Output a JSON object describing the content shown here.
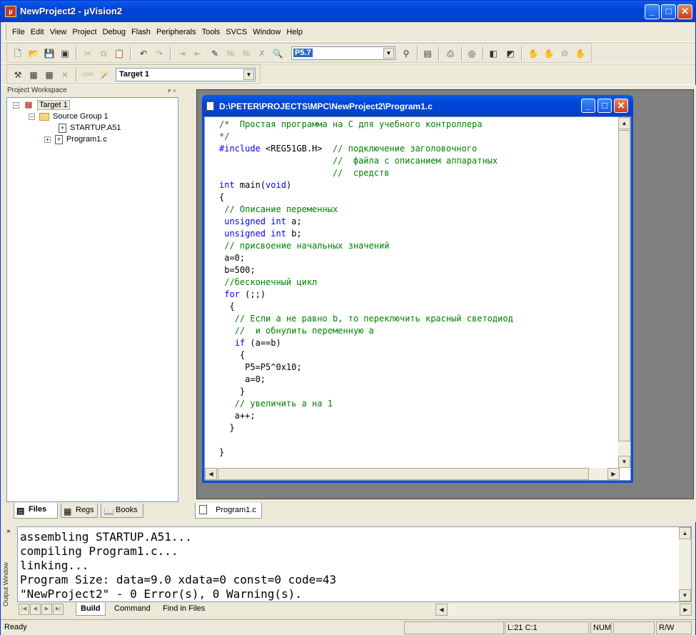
{
  "window": {
    "title": "NewProject2 - µVision2",
    "min_glyph": "_",
    "max_glyph": "□",
    "close_glyph": "✕"
  },
  "menu": [
    "File",
    "Edit",
    "View",
    "Project",
    "Debug",
    "Flash",
    "Peripherals",
    "Tools",
    "SVCS",
    "Window",
    "Help"
  ],
  "toolbar": {
    "find_combo_value": "P5.7",
    "target_combo_value": "Target 1",
    "load_label": "LOAD"
  },
  "workspace": {
    "title": "Project Workspace",
    "title_controls": "▾ ×",
    "tree": {
      "target": "Target 1",
      "group": "Source Group 1",
      "files": [
        "STARTUP.A51",
        "Program1.c"
      ]
    },
    "tabs": [
      "Files",
      "Regs",
      "Books"
    ]
  },
  "editor": {
    "title": "D:\\PETER\\PROJECTS\\MPC\\NewProject2\\Program1.c",
    "tab_label": "Program1.c",
    "code_lines": [
      "/*  Простая программа на С для учебного контроллера",
      "*/",
      "#include <REG51GB.H>  // подключение заголовочного",
      "                      //  файла с описанием аппаратных",
      "                      //  средств",
      "int main(void)",
      "{",
      " // Описание переменных",
      " unsigned int a;",
      " unsigned int b;",
      " // присвоение начальных значений",
      " a=0;",
      " b=500;",
      " //бесконечный цикл",
      " for (;;)",
      "  {",
      "   // Если а не равно b, то переключить красный светодиод",
      "   //  и обнулить переменную а",
      "   if (a==b)",
      "    {",
      "     P5=P5^0x10;",
      "     a=0;",
      "    }",
      "   // увеличить а на 1",
      "   a++;",
      "  }",
      "",
      "}"
    ]
  },
  "output": {
    "title": "Output Window",
    "close_glyph": "×",
    "lines": [
      "assembling STARTUP.A51...",
      "compiling Program1.c...",
      "linking...",
      "Program Size: data=9.0 xdata=0 const=0 code=43",
      "\"NewProject2\" - 0 Error(s), 0 Warning(s)."
    ],
    "tabs": [
      "Build",
      "Command",
      "Find in Files"
    ]
  },
  "status": {
    "ready": "Ready",
    "position": "L:21 C:1",
    "num": "NUM",
    "rw": "R/W"
  }
}
